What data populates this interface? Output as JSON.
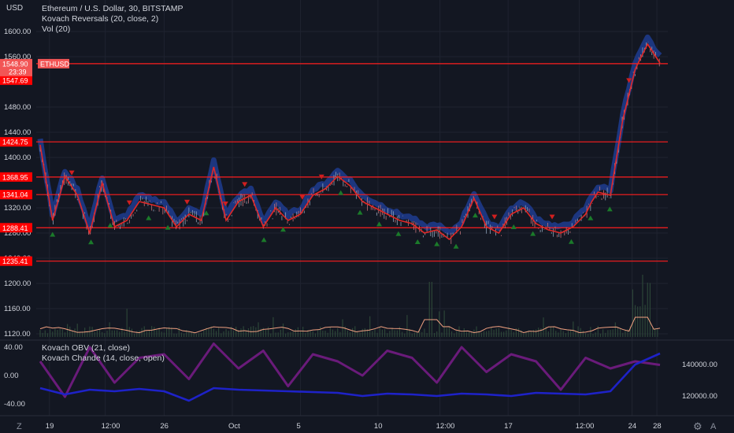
{
  "header": {
    "currency": "USD",
    "legend_main": "Ethereum / U.S. Dollar, 30, BITSTAMP",
    "legend_ind1": "Kovach Reversals (20, close, 2)",
    "legend_ind2": "Vol (20)",
    "legend_ind3": "Kovach OBV (21, close)",
    "legend_ind4": "Kovach Chande (14, close, open)"
  },
  "chart_data": [
    {
      "type": "line",
      "title": "Ethereum / U.S. Dollar, 30, BITSTAMP",
      "ylim": [
        1115,
        1610
      ],
      "y_ticks": [
        {
          "value": 1600,
          "label": "1600.00"
        },
        {
          "value": 1560,
          "label": "1560.00"
        },
        {
          "value": 1480,
          "label": "1480.00"
        },
        {
          "value": 1440,
          "label": "1440.00"
        },
        {
          "value": 1400,
          "label": "1400.00"
        },
        {
          "value": 1320,
          "label": "1320.00"
        },
        {
          "value": 1280,
          "label": "1280.00"
        },
        {
          "value": 1240,
          "label": "1240.00"
        },
        {
          "value": 1200,
          "label": "1200.00"
        },
        {
          "value": 1160,
          "label": "1160.00"
        },
        {
          "value": 1120,
          "label": "1120.00"
        }
      ],
      "x_ticks": [
        "19",
        "12:00",
        "26",
        "Oct",
        "5",
        "10",
        "12:00",
        "17",
        "12:00",
        "24",
        "28"
      ],
      "price_series": {
        "name": "ETHUSD",
        "x": [
          0,
          2,
          4,
          6,
          8,
          10,
          12,
          14,
          16,
          18,
          20,
          22,
          24,
          26,
          28,
          30,
          32,
          34,
          36,
          38,
          40,
          42,
          44,
          46,
          48,
          50,
          52,
          54,
          56,
          58,
          60,
          62,
          64,
          66,
          68,
          70,
          72,
          74,
          76,
          78,
          80,
          82,
          84,
          86,
          88,
          89,
          90,
          92,
          94,
          96,
          98,
          100
        ],
        "values": [
          1420,
          1300,
          1370,
          1340,
          1280,
          1360,
          1290,
          1300,
          1330,
          1325,
          1320,
          1290,
          1310,
          1300,
          1385,
          1300,
          1330,
          1340,
          1290,
          1320,
          1300,
          1310,
          1340,
          1350,
          1370,
          1355,
          1330,
          1320,
          1310,
          1300,
          1295,
          1280,
          1285,
          1270,
          1290,
          1335,
          1290,
          1280,
          1310,
          1320,
          1295,
          1285,
          1280,
          1290,
          1310,
          1330,
          1345,
          1340,
          1460,
          1540,
          1580,
          1550
        ]
      },
      "levels": [
        {
          "value": 1548.9,
          "label": "1548.90"
        },
        {
          "value": 1547.69,
          "label": "1547.69"
        },
        {
          "value": 1424.75,
          "label": "1424.75"
        },
        {
          "value": 1368.95,
          "label": "1368.95"
        },
        {
          "value": 1341.04,
          "label": "1341.04"
        },
        {
          "value": 1288.41,
          "label": "1288.41"
        },
        {
          "value": 1235.41,
          "label": "1235.41"
        }
      ],
      "last_price": {
        "value": 1548.9,
        "label": "1548.90",
        "symbol": "ETHUSD",
        "countdown": "23:39"
      }
    },
    {
      "type": "line",
      "title": "Kovach OBV (21, close) / Kovach Chande (14, close, open)",
      "left_axis_ticks": [
        {
          "value": 40,
          "label": "40.00"
        },
        {
          "value": 0,
          "label": "0.00"
        },
        {
          "value": -40,
          "label": "-40.00"
        }
      ],
      "right_axis_ticks": [
        {
          "value": 140000,
          "label": "140000.00"
        },
        {
          "value": 120000,
          "label": "120000.00"
        }
      ],
      "series": [
        {
          "name": "Kovach Chande (14, close, open)",
          "color": "#6a1b7a",
          "x": [
            0,
            4,
            8,
            12,
            16,
            20,
            24,
            28,
            32,
            36,
            40,
            44,
            48,
            52,
            56,
            60,
            64,
            68,
            72,
            76,
            80,
            84,
            88,
            92,
            96,
            100
          ],
          "values": [
            20,
            -30,
            40,
            -10,
            25,
            30,
            -5,
            45,
            10,
            35,
            -15,
            30,
            20,
            0,
            35,
            25,
            -10,
            40,
            5,
            30,
            20,
            -20,
            25,
            10,
            20,
            15
          ]
        },
        {
          "name": "Kovach OBV (21, close)",
          "color": "#1e22c8",
          "x": [
            0,
            4,
            8,
            12,
            16,
            20,
            24,
            28,
            32,
            36,
            40,
            44,
            48,
            52,
            56,
            60,
            64,
            68,
            72,
            76,
            80,
            84,
            88,
            92,
            96,
            100
          ],
          "values": [
            125000,
            121000,
            124000,
            123000,
            124500,
            123000,
            117000,
            125000,
            124000,
            123500,
            123000,
            122500,
            122000,
            120000,
            121500,
            121000,
            120000,
            121500,
            121000,
            120000,
            122000,
            121500,
            121000,
            123000,
            140000,
            147000
          ]
        }
      ]
    }
  ],
  "colors": {
    "background": "#131722",
    "grid": "#1f2330",
    "level_line": "#ff1e1e",
    "level_label": "#ff0000",
    "last_price_label": "#f25555",
    "price_band": "#1e3a8a",
    "price_trend": "#e02828",
    "up_marker": "#1b7a2a",
    "down_marker": "#d01f1f",
    "volume_line": "#f0a080",
    "chande": "#6a1b7a",
    "obv": "#1e22c8"
  },
  "bottom_bar": {
    "left_icon": "Z",
    "right_icon": "A",
    "gear": "gear-icon"
  }
}
